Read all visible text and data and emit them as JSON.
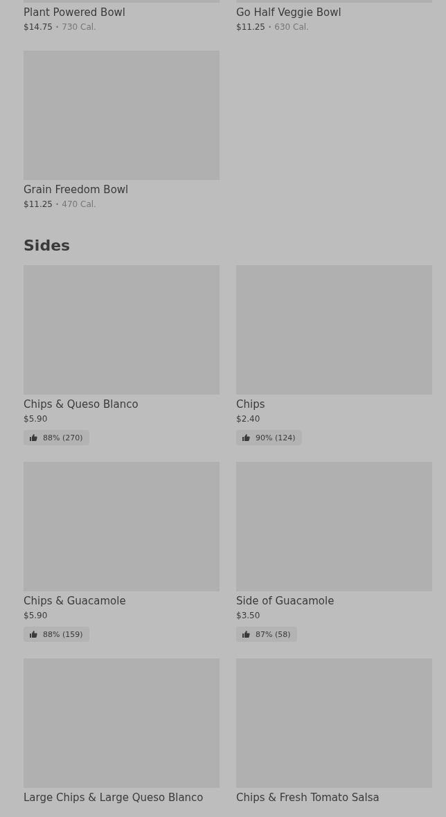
{
  "sections": [
    {
      "items": [
        {
          "name": "Plant Powered Bowl",
          "price": "$14.75",
          "separator": "•",
          "calories": "730 Cal."
        },
        {
          "name": "Go Half Veggie Bowl",
          "price": "$11.25",
          "separator": "•",
          "calories": "630 Cal."
        },
        {
          "name": "Grain Freedom Bowl",
          "price": "$11.25",
          "separator": "•",
          "calories": "470 Cal."
        }
      ]
    },
    {
      "title": "Sides",
      "items": [
        {
          "name": "Chips & Queso Blanco",
          "price": "$5.90",
          "rating": "88% (270)"
        },
        {
          "name": "Chips",
          "price": "$2.40",
          "rating": "90% (124)"
        },
        {
          "name": "Chips & Guacamole",
          "price": "$5.90",
          "rating": "88% (159)"
        },
        {
          "name": "Side of Guacamole",
          "price": "$3.50",
          "rating": "87% (58)"
        },
        {
          "name": "Large Chips & Large Queso Blanco"
        },
        {
          "name": "Chips & Fresh Tomato Salsa"
        }
      ]
    }
  ]
}
